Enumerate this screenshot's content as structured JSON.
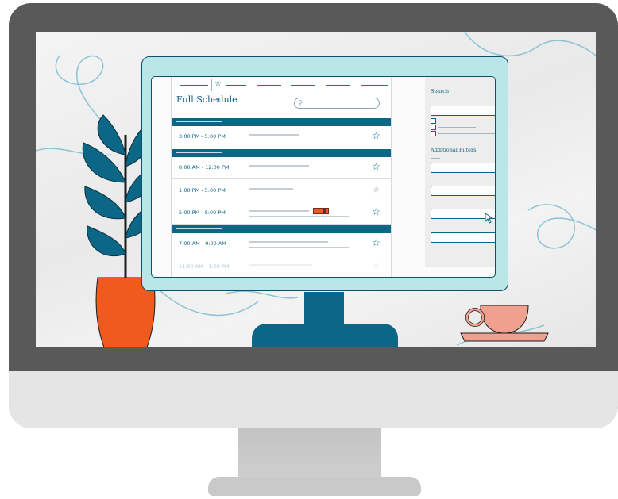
{
  "schedule": {
    "title": "Full Schedule",
    "rows": [
      {
        "time": "3:00 PM - 5:00 PM",
        "starred": false
      },
      {
        "time": "8:00 AM - 12:00 PM",
        "starred": false
      },
      {
        "time": "1:00 PM - 5:00 PM",
        "starred": true
      },
      {
        "time": "5:00 PM - 8:00 PM",
        "starred": false
      },
      {
        "time": "7:00 AM - 9:00 AM",
        "starred": false
      },
      {
        "time": "11:00 AM - 1:00 PM",
        "starred": false
      }
    ]
  },
  "filters": {
    "search_label": "Search",
    "additional_label": "Additional Filters"
  },
  "icons": {
    "tab": "star-outline-icon",
    "search": "magnifier-icon",
    "favorite": "star-icon",
    "select": "updown-arrow-icon",
    "cursor": "mouse-pointer-icon"
  },
  "colors": {
    "bezel": "#595959",
    "accent": "#0b6785",
    "monitor_frame": "#b9e6e7",
    "plant_pot": "#f05a1e",
    "cup": "#f0a08f",
    "tag": "#ef5a24"
  }
}
